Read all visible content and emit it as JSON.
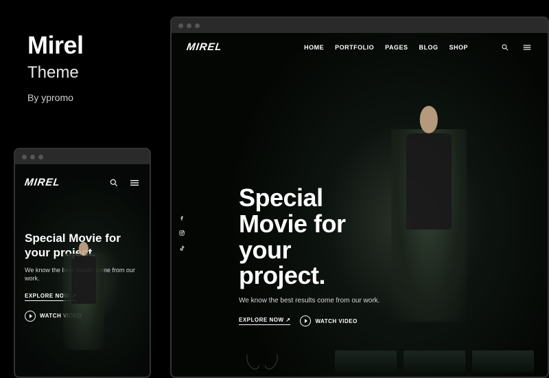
{
  "info": {
    "title": "Mirel",
    "subtitle": "Theme",
    "author": "By ypromo"
  },
  "brand": "MIREL",
  "nav": {
    "items": [
      "HOME",
      "PORTFOLIO",
      "PAGES",
      "BLOG",
      "SHOP"
    ]
  },
  "hero": {
    "headline_desktop": "Special\nMovie for\nyour\nproject.",
    "headline_mobile": "Special Movie for your project.",
    "tagline": "We know the best results come from our work.",
    "explore": "EXPLORE NOW ↗",
    "watch": "WATCH VIDEO"
  },
  "socials": [
    "facebook",
    "instagram",
    "tiktok"
  ]
}
